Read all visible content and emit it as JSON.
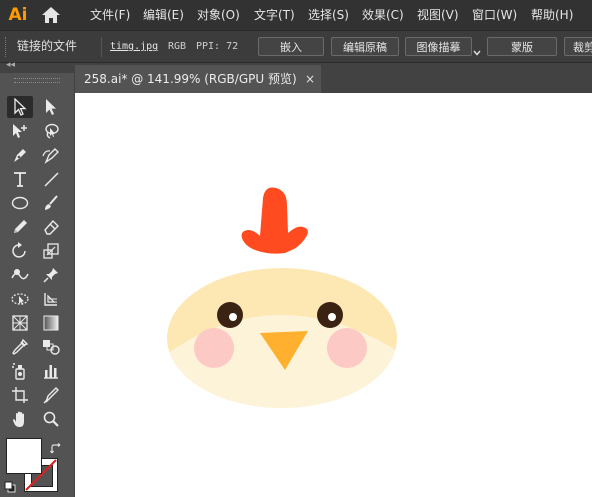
{
  "app": {
    "logo_text": "Ai"
  },
  "menu": {
    "items": [
      {
        "label": "文件(F)"
      },
      {
        "label": "编辑(E)"
      },
      {
        "label": "对象(O)"
      },
      {
        "label": "文字(T)"
      },
      {
        "label": "选择(S)"
      },
      {
        "label": "效果(C)"
      },
      {
        "label": "视图(V)"
      },
      {
        "label": "窗口(W)"
      },
      {
        "label": "帮助(H)"
      }
    ]
  },
  "control_bar": {
    "linked_file_label": "链接的文件",
    "file_name": "timg.jpg",
    "color_mode": "RGB",
    "ppi": "PPI: 72",
    "buttons": {
      "embed": "嵌入",
      "edit_original": "编辑原稿",
      "image_trace": "图像描摹",
      "mask": "蒙版",
      "crop": "裁剪"
    }
  },
  "document_tab": {
    "title": "258.ai* @ 141.99% (RGB/GPU 预览)",
    "close_glyph": "×"
  },
  "tools": [
    {
      "name": "selection-tool",
      "icon": "arrow-icon"
    },
    {
      "name": "direct-selection-tool",
      "icon": "white-arrow-icon"
    },
    {
      "name": "group-selection-tool",
      "icon": "plus-arrow-icon"
    },
    {
      "name": "lasso-tool",
      "icon": "lasso-icon"
    },
    {
      "name": "pen-tool",
      "icon": "pen-icon"
    },
    {
      "name": "curvature-tool",
      "icon": "curvature-icon"
    },
    {
      "name": "type-tool",
      "icon": "type-icon"
    },
    {
      "name": "line-tool",
      "icon": "line-icon"
    },
    {
      "name": "ellipse-tool",
      "icon": "ellipse-icon"
    },
    {
      "name": "paintbrush-tool",
      "icon": "brush-icon"
    },
    {
      "name": "pencil-tool",
      "icon": "pencil-icon"
    },
    {
      "name": "eraser-tool",
      "icon": "eraser-icon"
    },
    {
      "name": "rotate-tool",
      "icon": "rotate-icon"
    },
    {
      "name": "scale-tool",
      "icon": "scale-icon"
    },
    {
      "name": "warp-tool",
      "icon": "warp-icon"
    },
    {
      "name": "puppet-warp-tool",
      "icon": "pin-icon"
    },
    {
      "name": "free-transform-tool",
      "icon": "free-transform-icon"
    },
    {
      "name": "shape-builder-tool",
      "icon": "shape-builder-icon"
    },
    {
      "name": "perspective-grid-tool",
      "icon": "grid-icon"
    },
    {
      "name": "gradient-tool",
      "icon": "gradient-icon"
    },
    {
      "name": "eyedropper-tool",
      "icon": "eyedropper-icon"
    },
    {
      "name": "blend-tool",
      "icon": "blend-icon"
    },
    {
      "name": "symbol-sprayer-tool",
      "icon": "sprayer-icon"
    },
    {
      "name": "column-graph-tool",
      "icon": "graph-icon"
    },
    {
      "name": "artboard-tool",
      "icon": "artboard-icon"
    },
    {
      "name": "slice-tool",
      "icon": "slice-icon"
    },
    {
      "name": "hand-tool",
      "icon": "hand-icon"
    },
    {
      "name": "zoom-tool",
      "icon": "zoom-icon"
    }
  ],
  "colors": {
    "ui_dark": "#323232",
    "ui_panel": "#535353",
    "logo_orange": "#ff9a00",
    "chick_body": "#fde8b4",
    "chick_lower": "#fdf3d9",
    "comb_red": "#ff4b1f",
    "beak_orange": "#ffb02e",
    "cheek_pink": "#fcc9c5",
    "eye_brown": "#3b2314"
  }
}
